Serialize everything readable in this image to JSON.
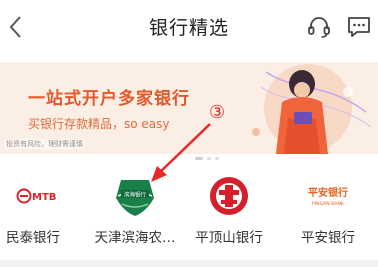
{
  "header": {
    "title": "银行精选"
  },
  "banner": {
    "title": "一站式开户多家银行",
    "subtitle": "买银行存款精品，so easy",
    "note": "投资有风险，理财需谨慎"
  },
  "annotation": {
    "marker": "③"
  },
  "banks": [
    {
      "name": "民泰银行",
      "logo_text": "MTB"
    },
    {
      "name": "天津滨海农…",
      "logo_text": "滨海银行"
    },
    {
      "name": "平顶山银行",
      "logo_text": ""
    },
    {
      "name": "平安银行",
      "logo_text": "平安银行",
      "logo_subtext": "PINGAN BANK"
    }
  ],
  "colors": {
    "accent": "#e8282a",
    "banner_bg": "#fbeee4",
    "banner_title": "#e4592c"
  }
}
